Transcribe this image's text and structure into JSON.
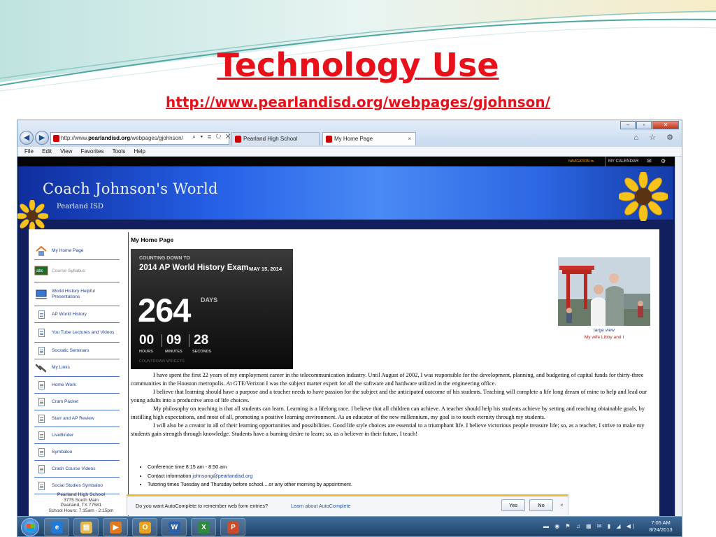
{
  "slide": {
    "title": "Technology Use",
    "url": "http://www.pearlandisd.org/webpages/gjohnson/"
  },
  "browser": {
    "address_prefix": "http://www.",
    "address_domain": "pearlandisd.org",
    "address_path": "/webpages/gjohnson/",
    "address_controls": "⌕ ▾ ≣ ↻ ✕",
    "tabs": [
      {
        "label": "Pearland High School"
      },
      {
        "label": "My Home Page"
      }
    ],
    "tab_close": "×",
    "window_buttons": {
      "minimize": "–",
      "maximize": "▫",
      "close": "✕"
    },
    "toolbar_icons": "⌂ ☆ ⚙",
    "menu": [
      "File",
      "Edit",
      "View",
      "Favorites",
      "Tools",
      "Help"
    ]
  },
  "site": {
    "navigation_label": "NAVIGATION ≫",
    "calendar_label": "MY CALENDAR",
    "mail_icon": "✉",
    "settings_icon": "⚙",
    "banner_title": "Coach Johnson's World",
    "banner_subtitle": "Pearland ISD",
    "sidebar": [
      {
        "label": "My Home Page",
        "icon": "house-icon"
      },
      {
        "label": "Course Syllabus",
        "icon": "chalkboard-icon"
      },
      {
        "label": "World History Helpful Presentations",
        "icon": "laptop-icon"
      },
      {
        "label": "AP World History",
        "icon": "document-icon"
      },
      {
        "label": "You Tube Lectures and Videos",
        "icon": "document-icon"
      },
      {
        "label": "Socratic Seminars",
        "icon": "document-icon"
      },
      {
        "label": "My Links",
        "icon": "link-icon"
      },
      {
        "label": "Home Work",
        "icon": "document-icon"
      },
      {
        "label": "Cram Packet",
        "icon": "document-icon"
      },
      {
        "label": "Starr and AP Review",
        "icon": "document-icon"
      },
      {
        "label": "LiveBinder",
        "icon": "document-icon"
      },
      {
        "label": "Symbaloo",
        "icon": "document-icon"
      },
      {
        "label": "Crash Course Videos",
        "icon": "document-icon"
      },
      {
        "label": "Social Studies Symbaloo",
        "icon": "document-icon"
      }
    ],
    "school": {
      "name": "Pearland High School",
      "street": "3775 South Main",
      "city": "Pearland, TX  77581",
      "hours": "School Hours: 7:15am - 2:15pm"
    },
    "page_title": "My Home Page",
    "countdown": {
      "lead": "COUNTING DOWN TO",
      "event": "2014 AP World History Exam",
      "date": "MAY 15, 2014",
      "days": "264",
      "days_label": "DAYS",
      "hours": "00",
      "minutes": "09",
      "seconds": "28",
      "hours_label": "HOURS",
      "minutes_label": "MINUTES",
      "seconds_label": "SECONDS",
      "widget": "COUNTDOWN WIDGETS"
    },
    "photo": {
      "link": "large view",
      "caption": "My wife Libby and I"
    },
    "paragraphs": [
      "I have spent the first 22 years of my employment career in the telecommunication industry.  Until August of 2002, I was responsible for the development, planning, and budgeting of capital funds for thirty-three communities in the Houston metropolis.  At GTE/Verizon I was the subject matter expert for all the software and hardware utilized in the engineering office.",
      "I believe that learning should have a purpose and a teacher needs to have passion for the subject and the anticipated outcome of his students.  Teaching will complete a life long dream of mine to help and lead our young adults into a productive area of life choices.",
      "My philosophy on teaching is that all students can learn.  Learning is a lifelong race.  I believe that all children can achieve.  A teacher should help his students achieve by setting and reaching obtainable goals, by instilling high expectations, and most of all, promoting a positive learning environment.  As an educator of the new millennium, my goal is to touch eternity through my students.",
      "I will also be a creator in all of their learning opportunities and possibilities.  Good life style choices are essential to a triumphant life.  I believe victorious people treasure life; so, as a teacher, I strive to make my students gain strength through knowledge.  Students have a burning desire to learn; so, as a believer in their future, I teach!"
    ],
    "bullets": {
      "conference": "Conference time 8:15 am - 8:50 am",
      "contact_label": "Contact information ",
      "contact_email": "johnsong@pearlandisd.org",
      "tutoring": "Tutoring times Tuesday and Thursday before school....or any other morning  by appointment."
    }
  },
  "autocomplete": {
    "question": "Do you want AutoComplete to remember web form entries?",
    "learn_more": "Learn about AutoComplete",
    "yes": "Yes",
    "no": "No",
    "close": "×"
  },
  "taskbar": {
    "items": [
      {
        "icon": "ie-icon",
        "glyph": "e"
      },
      {
        "icon": "folder-icon",
        "glyph": "▤"
      },
      {
        "icon": "media-player-icon",
        "glyph": "▶"
      },
      {
        "icon": "outlook-icon",
        "glyph": "O"
      },
      {
        "icon": "word-icon",
        "glyph": "W"
      },
      {
        "icon": "excel-icon",
        "glyph": "X"
      },
      {
        "icon": "powerpoint-icon",
        "glyph": "P"
      }
    ],
    "tray_icons": "▬ ◉ ⚑ ♫ ▦ ✉ ▮ ◢ ◀)",
    "time": "7:05 AM",
    "date": "8/24/2013"
  },
  "colors": {
    "title_red": "#e8101a",
    "banner_blue": "#2560e6",
    "link_blue": "#1d3e9a"
  }
}
